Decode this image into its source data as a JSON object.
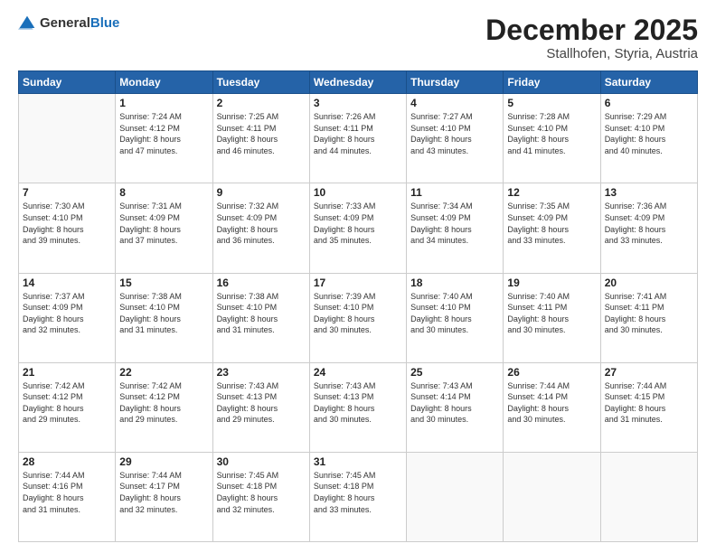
{
  "logo": {
    "general": "General",
    "blue": "Blue"
  },
  "header": {
    "title": "December 2025",
    "subtitle": "Stallhofen, Styria, Austria"
  },
  "days": [
    "Sunday",
    "Monday",
    "Tuesday",
    "Wednesday",
    "Thursday",
    "Friday",
    "Saturday"
  ],
  "weeks": [
    [
      {
        "day": "",
        "info": ""
      },
      {
        "day": "1",
        "info": "Sunrise: 7:24 AM\nSunset: 4:12 PM\nDaylight: 8 hours\nand 47 minutes."
      },
      {
        "day": "2",
        "info": "Sunrise: 7:25 AM\nSunset: 4:11 PM\nDaylight: 8 hours\nand 46 minutes."
      },
      {
        "day": "3",
        "info": "Sunrise: 7:26 AM\nSunset: 4:11 PM\nDaylight: 8 hours\nand 44 minutes."
      },
      {
        "day": "4",
        "info": "Sunrise: 7:27 AM\nSunset: 4:10 PM\nDaylight: 8 hours\nand 43 minutes."
      },
      {
        "day": "5",
        "info": "Sunrise: 7:28 AM\nSunset: 4:10 PM\nDaylight: 8 hours\nand 41 minutes."
      },
      {
        "day": "6",
        "info": "Sunrise: 7:29 AM\nSunset: 4:10 PM\nDaylight: 8 hours\nand 40 minutes."
      }
    ],
    [
      {
        "day": "7",
        "info": "Sunrise: 7:30 AM\nSunset: 4:10 PM\nDaylight: 8 hours\nand 39 minutes."
      },
      {
        "day": "8",
        "info": "Sunrise: 7:31 AM\nSunset: 4:09 PM\nDaylight: 8 hours\nand 37 minutes."
      },
      {
        "day": "9",
        "info": "Sunrise: 7:32 AM\nSunset: 4:09 PM\nDaylight: 8 hours\nand 36 minutes."
      },
      {
        "day": "10",
        "info": "Sunrise: 7:33 AM\nSunset: 4:09 PM\nDaylight: 8 hours\nand 35 minutes."
      },
      {
        "day": "11",
        "info": "Sunrise: 7:34 AM\nSunset: 4:09 PM\nDaylight: 8 hours\nand 34 minutes."
      },
      {
        "day": "12",
        "info": "Sunrise: 7:35 AM\nSunset: 4:09 PM\nDaylight: 8 hours\nand 33 minutes."
      },
      {
        "day": "13",
        "info": "Sunrise: 7:36 AM\nSunset: 4:09 PM\nDaylight: 8 hours\nand 33 minutes."
      }
    ],
    [
      {
        "day": "14",
        "info": "Sunrise: 7:37 AM\nSunset: 4:09 PM\nDaylight: 8 hours\nand 32 minutes."
      },
      {
        "day": "15",
        "info": "Sunrise: 7:38 AM\nSunset: 4:10 PM\nDaylight: 8 hours\nand 31 minutes."
      },
      {
        "day": "16",
        "info": "Sunrise: 7:38 AM\nSunset: 4:10 PM\nDaylight: 8 hours\nand 31 minutes."
      },
      {
        "day": "17",
        "info": "Sunrise: 7:39 AM\nSunset: 4:10 PM\nDaylight: 8 hours\nand 30 minutes."
      },
      {
        "day": "18",
        "info": "Sunrise: 7:40 AM\nSunset: 4:10 PM\nDaylight: 8 hours\nand 30 minutes."
      },
      {
        "day": "19",
        "info": "Sunrise: 7:40 AM\nSunset: 4:11 PM\nDaylight: 8 hours\nand 30 minutes."
      },
      {
        "day": "20",
        "info": "Sunrise: 7:41 AM\nSunset: 4:11 PM\nDaylight: 8 hours\nand 30 minutes."
      }
    ],
    [
      {
        "day": "21",
        "info": "Sunrise: 7:42 AM\nSunset: 4:12 PM\nDaylight: 8 hours\nand 29 minutes."
      },
      {
        "day": "22",
        "info": "Sunrise: 7:42 AM\nSunset: 4:12 PM\nDaylight: 8 hours\nand 29 minutes."
      },
      {
        "day": "23",
        "info": "Sunrise: 7:43 AM\nSunset: 4:13 PM\nDaylight: 8 hours\nand 29 minutes."
      },
      {
        "day": "24",
        "info": "Sunrise: 7:43 AM\nSunset: 4:13 PM\nDaylight: 8 hours\nand 30 minutes."
      },
      {
        "day": "25",
        "info": "Sunrise: 7:43 AM\nSunset: 4:14 PM\nDaylight: 8 hours\nand 30 minutes."
      },
      {
        "day": "26",
        "info": "Sunrise: 7:44 AM\nSunset: 4:14 PM\nDaylight: 8 hours\nand 30 minutes."
      },
      {
        "day": "27",
        "info": "Sunrise: 7:44 AM\nSunset: 4:15 PM\nDaylight: 8 hours\nand 31 minutes."
      }
    ],
    [
      {
        "day": "28",
        "info": "Sunrise: 7:44 AM\nSunset: 4:16 PM\nDaylight: 8 hours\nand 31 minutes."
      },
      {
        "day": "29",
        "info": "Sunrise: 7:44 AM\nSunset: 4:17 PM\nDaylight: 8 hours\nand 32 minutes."
      },
      {
        "day": "30",
        "info": "Sunrise: 7:45 AM\nSunset: 4:18 PM\nDaylight: 8 hours\nand 32 minutes."
      },
      {
        "day": "31",
        "info": "Sunrise: 7:45 AM\nSunset: 4:18 PM\nDaylight: 8 hours\nand 33 minutes."
      },
      {
        "day": "",
        "info": ""
      },
      {
        "day": "",
        "info": ""
      },
      {
        "day": "",
        "info": ""
      }
    ]
  ]
}
